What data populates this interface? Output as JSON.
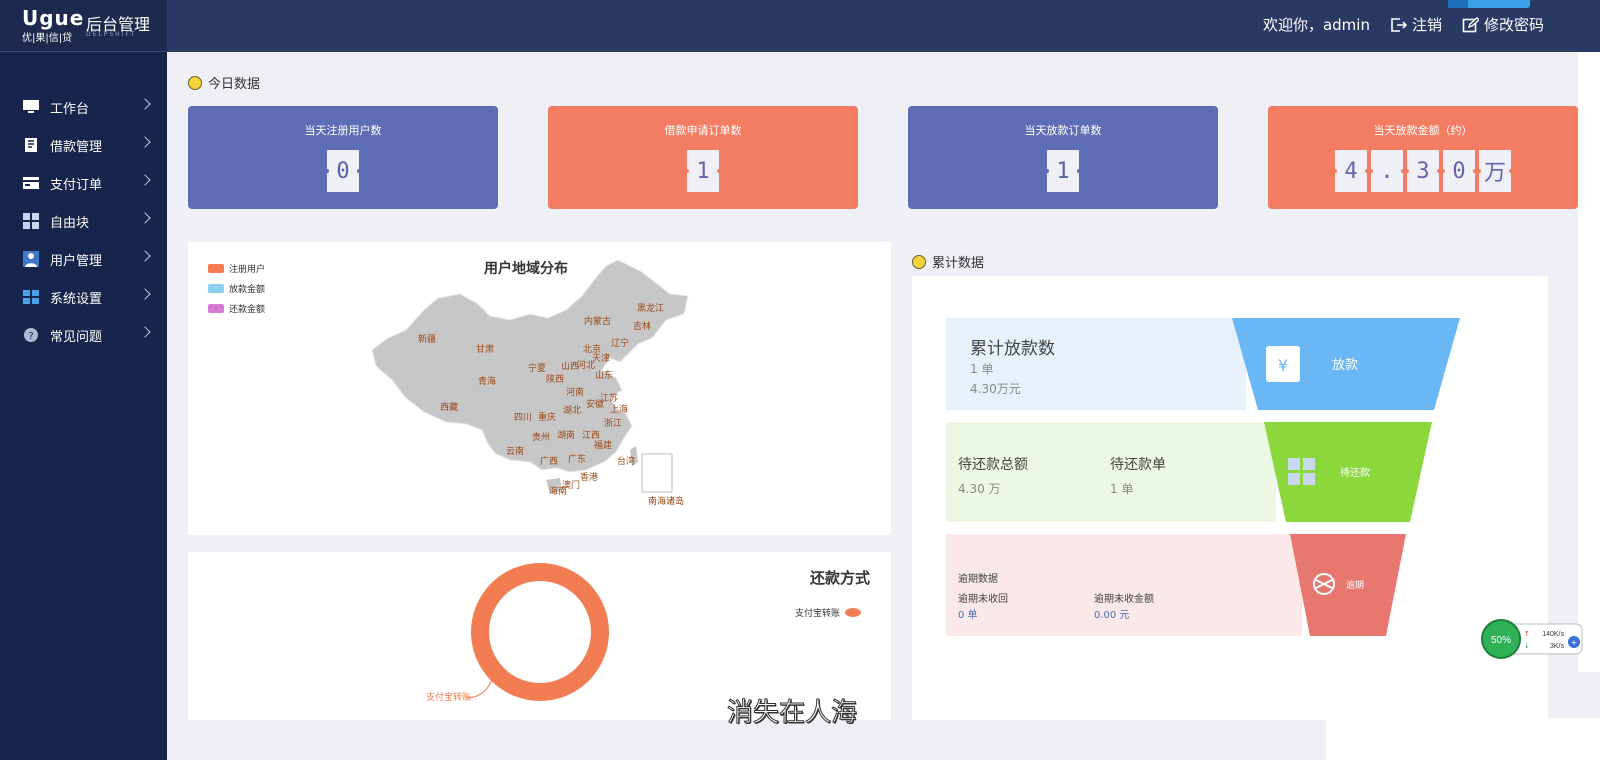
{
  "header": {
    "logo_mark": "Ugue",
    "logo_sub": "优|果|信|贷",
    "logo_en": "DELPSHIFT",
    "title": "后台管理",
    "welcome": "欢迎你，admin",
    "logout": "注销",
    "change_password": "修改密码"
  },
  "sidebar": {
    "items": [
      {
        "label": "工作台",
        "icon": "monitor-icon"
      },
      {
        "label": "借款管理",
        "icon": "document-icon"
      },
      {
        "label": "支付订单",
        "icon": "card-icon"
      },
      {
        "label": "自由块",
        "icon": "grid-icon"
      },
      {
        "label": "用户管理",
        "icon": "user-icon"
      },
      {
        "label": "系统设置",
        "icon": "windows-icon"
      },
      {
        "label": "常见问题",
        "icon": "question-icon"
      }
    ]
  },
  "today": {
    "title": "今日数据",
    "cards": [
      {
        "label": "当天注册用户数",
        "digits": [
          "0"
        ],
        "color": "#5f6db7"
      },
      {
        "label": "借款申请订单数",
        "digits": [
          "1"
        ],
        "color": "#f27d62"
      },
      {
        "label": "当天放款订单数",
        "digits": [
          "1"
        ],
        "color": "#5f6db7"
      },
      {
        "label": "当天放款金额（约）",
        "digits": [
          "4",
          ".",
          "3",
          "0",
          "万"
        ],
        "color": "#f27d62"
      }
    ]
  },
  "map": {
    "title": "用户地域分布",
    "legend": [
      {
        "label": "注册用户",
        "color": "#f27d52"
      },
      {
        "label": "放款金额",
        "color": "#8fd0f2"
      },
      {
        "label": "还款金额",
        "color": "#d77ad7"
      }
    ],
    "provinces": [
      "黑龙江",
      "吉林",
      "内蒙古",
      "辽宁",
      "北京",
      "天津",
      "河北",
      "山西",
      "山东",
      "新疆",
      "甘肃",
      "宁夏",
      "陕西",
      "青海",
      "河南",
      "江苏",
      "安徽",
      "上海",
      "西藏",
      "四川",
      "重庆",
      "湖北",
      "浙江",
      "贵州",
      "湖南",
      "江西",
      "福建",
      "云南",
      "广西",
      "广东",
      "台湾",
      "香港",
      "澳门",
      "海南",
      "南海诸岛"
    ]
  },
  "repay": {
    "title": "还款方式",
    "legend": "支付宝转账",
    "slice_label": "支付宝转账",
    "chart_data": {
      "type": "pie",
      "categories": [
        "支付宝转账"
      ],
      "values": [
        100
      ]
    }
  },
  "cumulative": {
    "title": "累计数据",
    "loan": {
      "title": "累计放款数",
      "count": "1 单",
      "amount": "4.30万元",
      "funnel_label": "放款"
    },
    "pending": {
      "total_label": "待还款总额",
      "total_value": "4.30 万",
      "count_label": "待还款单",
      "count_value": "1 单",
      "funnel_label": "待还款"
    },
    "overdue": {
      "title": "逾期数据",
      "uncollected_label": "逾期未收回",
      "uncollected_value": "0 单",
      "amount_label": "逾期未收金额",
      "amount_value": "0.00 元",
      "funnel_label": "逾期"
    }
  },
  "speed": {
    "percent": "50%",
    "up": "140K/s",
    "down": "3K/s"
  },
  "watermark": "消失在人海"
}
